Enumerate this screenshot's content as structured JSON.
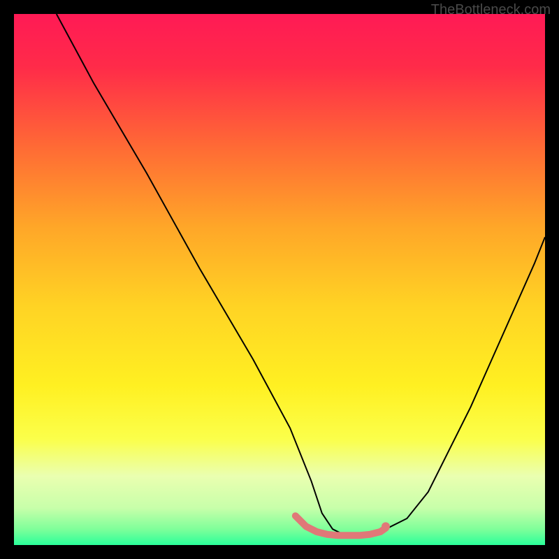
{
  "watermark": "TheBottleneck.com",
  "chart_data": {
    "type": "line",
    "title": "",
    "xlabel": "",
    "ylabel": "",
    "xlim": [
      0,
      100
    ],
    "ylim": [
      0,
      100
    ],
    "background": {
      "type": "vertical-gradient",
      "stops": [
        {
          "offset": 0.0,
          "color": "#ff1a55"
        },
        {
          "offset": 0.1,
          "color": "#ff2b49"
        },
        {
          "offset": 0.25,
          "color": "#ff6a35"
        },
        {
          "offset": 0.4,
          "color": "#ffa628"
        },
        {
          "offset": 0.55,
          "color": "#ffd324"
        },
        {
          "offset": 0.7,
          "color": "#fff022"
        },
        {
          "offset": 0.8,
          "color": "#fbff4a"
        },
        {
          "offset": 0.87,
          "color": "#eaffb0"
        },
        {
          "offset": 0.93,
          "color": "#c8ffaa"
        },
        {
          "offset": 0.97,
          "color": "#7fff9a"
        },
        {
          "offset": 1.0,
          "color": "#2aff9a"
        }
      ]
    },
    "series": [
      {
        "name": "bottleneck-curve",
        "color": "#000000",
        "width": 2,
        "x": [
          8,
          15,
          25,
          35,
          45,
          52,
          56,
          58,
          60,
          62,
          64,
          66,
          68,
          70,
          74,
          78,
          82,
          86,
          90,
          94,
          98,
          100
        ],
        "y": [
          100,
          87,
          70,
          52,
          35,
          22,
          12,
          6,
          3,
          2,
          2,
          2,
          2,
          3,
          5,
          10,
          18,
          26,
          35,
          44,
          53,
          58
        ]
      },
      {
        "name": "optimal-zone-highlight",
        "color": "#e07878",
        "width": 10,
        "linecap": "round",
        "x": [
          53,
          55,
          57,
          59,
          61,
          63,
          65,
          67,
          69,
          70
        ],
        "y": [
          5.5,
          3.5,
          2.5,
          2.0,
          1.8,
          1.8,
          1.8,
          2.0,
          2.5,
          3.2
        ]
      }
    ],
    "markers": [
      {
        "name": "dot-right",
        "x": 70,
        "y": 3.5,
        "r": 6,
        "color": "#e07878"
      }
    ]
  }
}
